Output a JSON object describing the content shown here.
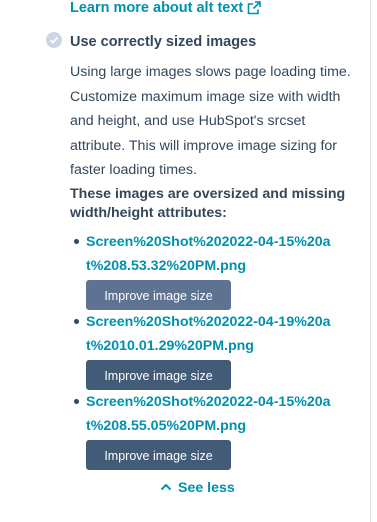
{
  "learn_more": {
    "label": "Learn more about alt text",
    "icon": "external-link-icon"
  },
  "check": {
    "title": "Use correctly sized images",
    "icon": "check-circle-icon",
    "status_color": "#cbd6e2"
  },
  "description": "Using large images slows page loading time. Customize maximum image size with width and height, and use HubSpot's srcset attribute. This will improve image sizing for faster loading times.",
  "subheading": "These images are oversized and missing width/height attributes:",
  "images": [
    {
      "file": "Screen%20Shot%202022-04-15%20at%208.53.32%20PM.png",
      "button": "Improve image size"
    },
    {
      "file": "Screen%20Shot%202022-04-19%20at%2010.01.29%20PM.png",
      "button": "Improve image size"
    },
    {
      "file": "Screen%20Shot%202022-04-15%20at%208.55.05%20PM.png",
      "button": "Improve image size"
    }
  ],
  "see_less": {
    "label": "See less",
    "icon": "chevron-up-icon"
  },
  "colors": {
    "link": "#0091ae",
    "text": "#33475b",
    "button": "#425b76",
    "button_hover": "#5e7392"
  }
}
